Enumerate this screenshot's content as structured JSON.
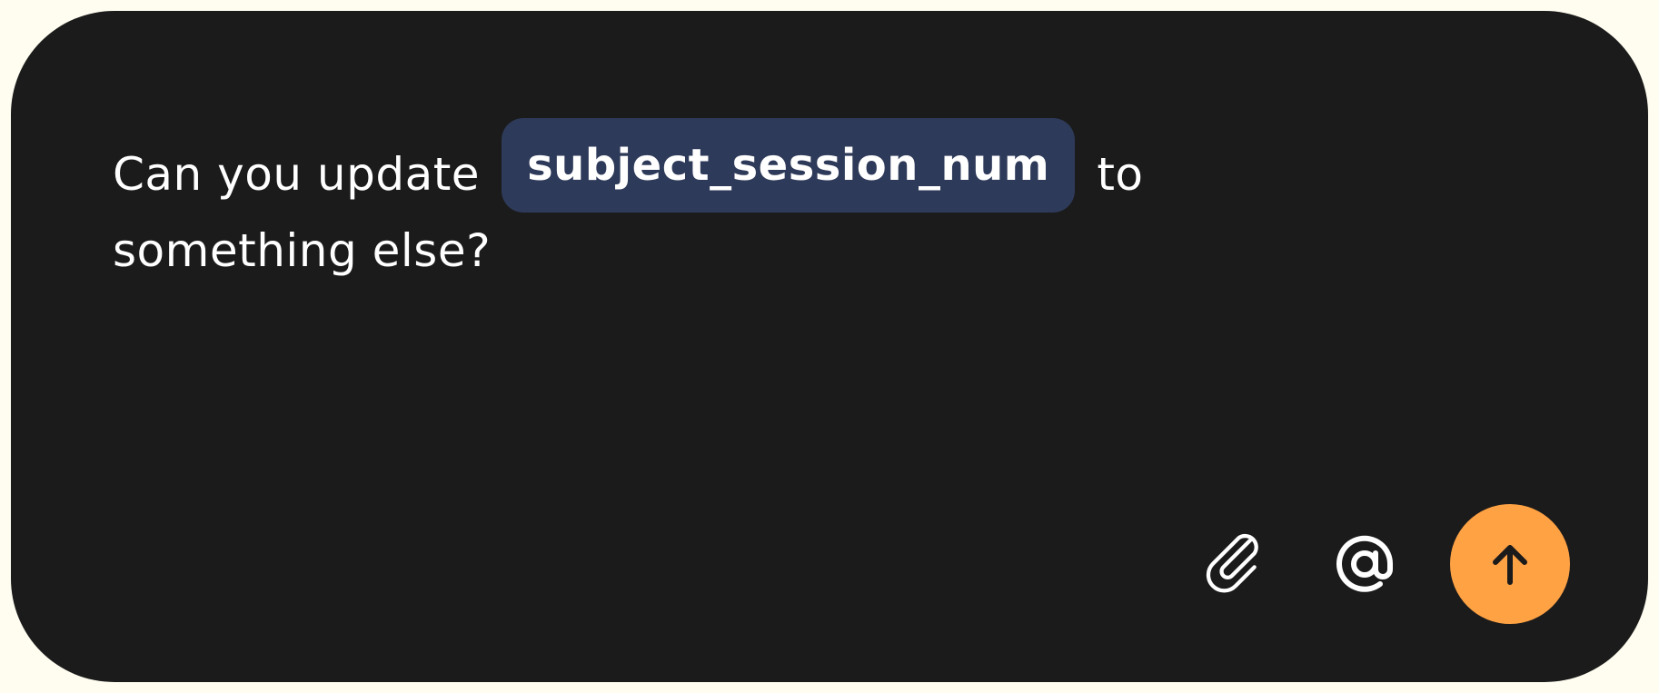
{
  "composer": {
    "message_before_chip": "Can you update",
    "chip_label": "subject_session_num",
    "message_after_chip": "to",
    "message_second_line": "something else?"
  },
  "actions": {
    "attach_icon": "paperclip-icon",
    "mention_icon": "at-sign-icon",
    "send_icon": "arrow-up-icon"
  },
  "colors": {
    "background": "#1b1b1b",
    "chip": "#2e3a59",
    "send_button": "#ffa244",
    "outer": "#fffdf0"
  }
}
